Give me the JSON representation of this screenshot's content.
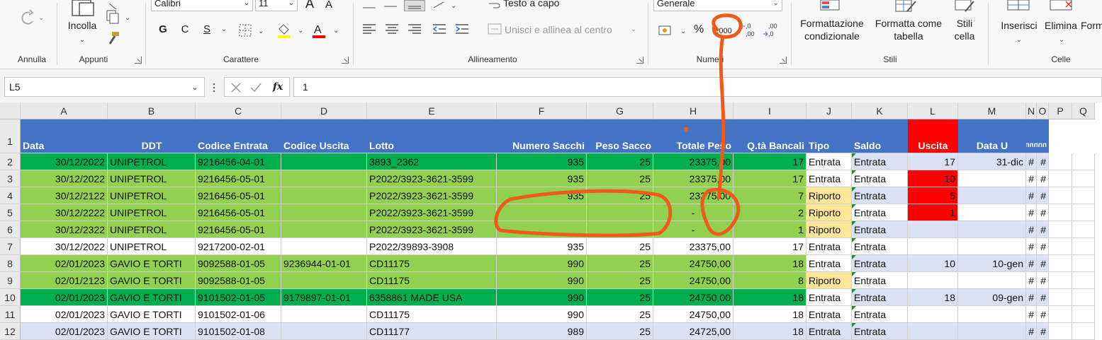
{
  "ribbon": {
    "undo": {
      "group": "Annulla"
    },
    "clipboard": {
      "paste": "Incolla",
      "group": "Appunti"
    },
    "font": {
      "name": "Calibri",
      "size": "11",
      "bold": "G",
      "italic": "C",
      "underline": "S",
      "font_color_glyph": "A",
      "grow_glyph": "A",
      "shrink_glyph": "A",
      "group": "Carattere"
    },
    "alignment": {
      "wrap": "Testo a capo",
      "merge": "Unisci e allinea al centro",
      "group": "Allineamento"
    },
    "number": {
      "format": "Generale",
      "percent": "%",
      "thousands": ",000",
      "inc_dec": "←0 ,00",
      "dec_dec": ",00 →,0",
      "group": "Numeri"
    },
    "styles": {
      "cond_format": "Formattazione condizionale",
      "format_table": "Formatta come tabella",
      "cell_styles": "Stili cella",
      "group": "Stili"
    },
    "cells": {
      "insert": "Inserisci",
      "delete": "Elimina",
      "format": "Form",
      "group": "Celle"
    }
  },
  "formula_bar": {
    "name_box": "L5",
    "fx": "fx",
    "value": "1"
  },
  "columns": [
    "A",
    "B",
    "C",
    "D",
    "E",
    "F",
    "G",
    "H",
    "I",
    "J",
    "K",
    "L",
    "M",
    "N",
    "O",
    "P",
    "Q"
  ],
  "header_row": {
    "num": "1",
    "cells": [
      "Data",
      "DDT",
      "Codice Entrata",
      "Codice Uscita",
      "Lotto",
      "Numero Sacchi",
      "Peso Sacco",
      "Totale Peso",
      "Q.tà Bancali",
      "Tipo",
      "Saldo",
      "Uscita",
      "Data U",
      "nnnnn"
    ]
  },
  "rows": [
    {
      "num": "2",
      "cells": [
        "30/12/2022",
        "UNIPETROL",
        "9216456-04-01",
        "",
        "3893_2362",
        "935",
        "25",
        "23375,00",
        "17",
        "Entrata",
        "Entrata",
        "17",
        "31-dic",
        "#",
        "#"
      ]
    },
    {
      "num": "3",
      "cells": [
        "30/12/2022",
        "UNIPETROL",
        "9216456-05-01",
        "",
        "P2022/3923-3621-3599",
        "935",
        "25",
        "23375,00",
        "17",
        "Entrata",
        "Entrata",
        "10",
        "",
        "#",
        "#"
      ]
    },
    {
      "num": "4",
      "cells": [
        "30/12/2122",
        "UNIPETROL",
        "9216456-05-01",
        "",
        "P2022/3923-3621-3599",
        "935",
        "25",
        "23375,00",
        "7",
        "Riporto",
        "Entrata",
        "5",
        "",
        "#",
        "#"
      ]
    },
    {
      "num": "5",
      "cells": [
        "30/12/2222",
        "UNIPETROL",
        "9216456-05-01",
        "",
        "P2022/3923-3621-3599",
        "",
        "",
        "-",
        "2",
        "Riporto",
        "Entrata",
        "1",
        "",
        "#",
        "#"
      ]
    },
    {
      "num": "6",
      "cells": [
        "30/12/2322",
        "UNIPETROL",
        "9216456-05-01",
        "",
        "P2022/3923-3621-3599",
        "",
        "",
        "-",
        "1",
        "Riporto",
        "Entrata",
        "",
        "",
        "#",
        "#"
      ]
    },
    {
      "num": "7",
      "cells": [
        "30/12/2022",
        "UNIPETROL",
        "9217200-02-01",
        "",
        "P2022/39893-3908",
        "935",
        "25",
        "23375,00",
        "17",
        "Entrata",
        "Entrata",
        "",
        "",
        "#",
        "#"
      ]
    },
    {
      "num": "8",
      "cells": [
        "02/01/2023",
        "GAVIO E TORTI",
        "9092588-01-05",
        "9236944-01-01",
        "CD11175",
        "990",
        "25",
        "24750,00",
        "18",
        "Entrata",
        "Entrata",
        "10",
        "10-gen",
        "#",
        "#"
      ]
    },
    {
      "num": "9",
      "cells": [
        "02/01/2123",
        "GAVIO E TORTI",
        "9092588-01-05",
        "",
        "CD11175",
        "990",
        "25",
        "24750,00",
        "8",
        "Riporto",
        "Entrata",
        "",
        "",
        "#",
        "#"
      ]
    },
    {
      "num": "10",
      "cells": [
        "02/01/2023",
        "GAVIO E TORTI",
        "9101502-01-05",
        "9179897-01-01",
        "6358861 MADE USA",
        "990",
        "25",
        "24750,00",
        "18",
        "Entrata",
        "Entrata",
        "18",
        "09-gen",
        "#",
        "#"
      ]
    },
    {
      "num": "11",
      "cells": [
        "02/01/2023",
        "GAVIO E TORTI",
        "9101502-01-06",
        "",
        "CD11175",
        "990",
        "25",
        "24750,00",
        "18",
        "Entrata",
        "Entrata",
        "",
        "",
        "#",
        "#"
      ]
    },
    {
      "num": "12",
      "cells": [
        "02/01/2023",
        "GAVIO E TORTI",
        "9101502-01-08",
        "",
        "CD11177",
        "989",
        "25",
        "24725,00",
        "18",
        "Entrata",
        "Entrata",
        "",
        "",
        "#",
        "#"
      ]
    }
  ],
  "colors": {
    "header_blue": "#4472c4",
    "green_dark": "#00b050",
    "green_light": "#92d050",
    "riporto_yellow": "#ffe699",
    "uscita_red": "#ff0000",
    "band_blue": "#d9e1f2",
    "annotation_orange": "#f05a1a"
  }
}
